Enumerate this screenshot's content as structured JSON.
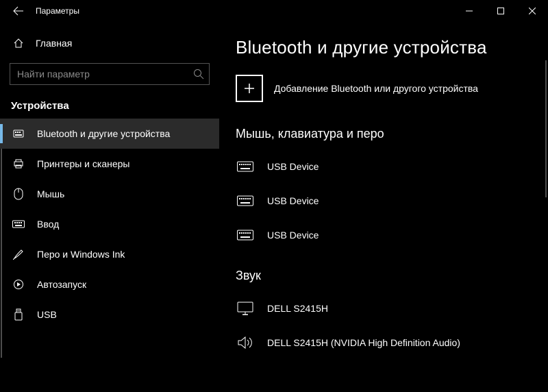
{
  "titlebar": {
    "title": "Параметры"
  },
  "sidebar": {
    "home_label": "Главная",
    "search_placeholder": "Найти параметр",
    "section_title": "Устройства",
    "items": [
      {
        "label": "Bluetooth и другие устройства",
        "icon": "bluetooth",
        "selected": true
      },
      {
        "label": "Принтеры и сканеры",
        "icon": "printer",
        "selected": false
      },
      {
        "label": "Мышь",
        "icon": "mouse",
        "selected": false
      },
      {
        "label": "Ввод",
        "icon": "keyboard",
        "selected": false
      },
      {
        "label": "Перо и Windows Ink",
        "icon": "pen",
        "selected": false
      },
      {
        "label": "Автозапуск",
        "icon": "autoplay",
        "selected": false
      },
      {
        "label": "USB",
        "icon": "usb",
        "selected": false
      }
    ]
  },
  "main": {
    "heading": "Bluetooth и другие устройства",
    "add_label": "Добавление Bluetooth или другого устройства",
    "groups": [
      {
        "title": "Мышь, клавиатура и перо",
        "devices": [
          {
            "label": "USB Device",
            "icon": "keyboard"
          },
          {
            "label": "USB Device",
            "icon": "keyboard"
          },
          {
            "label": "USB Device",
            "icon": "keyboard"
          }
        ]
      },
      {
        "title": "Звук",
        "devices": [
          {
            "label": "DELL S2415H",
            "icon": "monitor"
          },
          {
            "label": "DELL S2415H (NVIDIA High Definition Audio)",
            "icon": "speaker"
          }
        ]
      }
    ]
  }
}
